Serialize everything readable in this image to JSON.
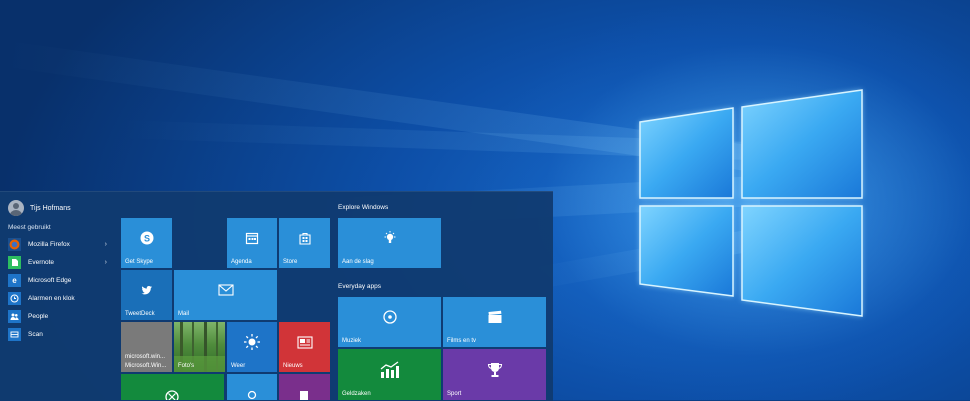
{
  "start_menu": {
    "user_name": "Tijs Hofmans",
    "most_used_label": "Meest gebruikt",
    "apps": [
      {
        "label": "Mozilla Firefox",
        "icon": "firefox-icon",
        "color": "#e66000",
        "has_arrow": true
      },
      {
        "label": "Evernote",
        "icon": "evernote-icon",
        "color": "#2dbe60",
        "has_arrow": true
      },
      {
        "label": "Microsoft Edge",
        "icon": "edge-icon",
        "color": "#1e74c8",
        "has_arrow": false
      },
      {
        "label": "Alarmen en klok",
        "icon": "alarm-clock-icon",
        "color": "#1e74c8",
        "has_arrow": false
      },
      {
        "label": "People",
        "icon": "people-icon",
        "color": "#1e74c8",
        "has_arrow": false
      },
      {
        "label": "Scan",
        "icon": "scan-icon",
        "color": "#1e74c8",
        "has_arrow": false
      }
    ],
    "tiles": {
      "get_skype": "Get Skype",
      "agenda": "Agenda",
      "store": "Store",
      "tweetdeck": "TweetDeck",
      "mail": "Mail",
      "microsoft_1": "microsoft.win...",
      "microsoft_2": "Microsoft.Win...",
      "fotos": "Foto's",
      "weer": "Weer",
      "nieuws": "Nieuws"
    },
    "explore_title": "Explore Windows",
    "explore_tiles": {
      "aan_de_slag": "Aan de slag"
    },
    "everyday_title": "Everyday apps",
    "everyday_tiles": {
      "muziek": "Muziek",
      "films": "Films en tv",
      "geldzaken": "Geldzaken",
      "sport": "Sport"
    }
  },
  "colors": {
    "tile_blue": "#2a8fd8",
    "tile_red": "#d13438",
    "tile_green": "#138a3d",
    "tile_purple": "#6a3aa8",
    "tile_gray": "#7a7a7a"
  }
}
